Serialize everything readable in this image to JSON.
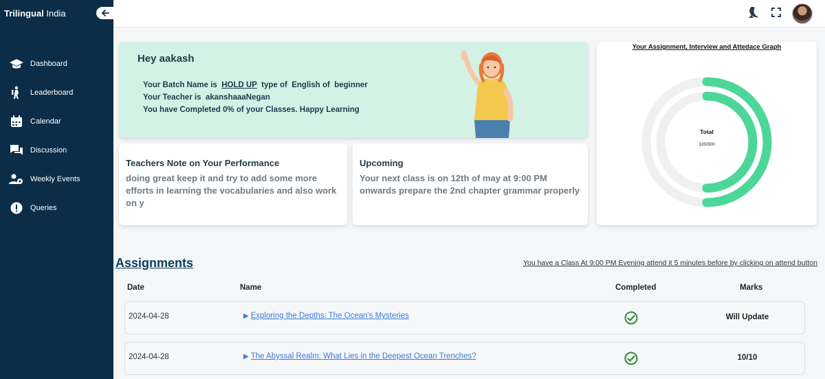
{
  "brand": {
    "bold": "Trilingual",
    "light": "India"
  },
  "sidebar": {
    "items": [
      {
        "label": "Dashboard",
        "icon": "graduation-cap-icon"
      },
      {
        "label": "Leaderboard",
        "icon": "hiking-person-icon"
      },
      {
        "label": "Calendar",
        "icon": "calendar-icon"
      },
      {
        "label": "Discussion",
        "icon": "chat-bubbles-icon"
      },
      {
        "label": "Weekly Events",
        "icon": "users-gear-icon"
      },
      {
        "label": "Queries",
        "icon": "exclamation-circle-icon"
      }
    ]
  },
  "topbar": {
    "icons": [
      "theme-toggle-icon",
      "fullscreen-icon",
      "avatar"
    ]
  },
  "welcome": {
    "greeting": "Hey aakash",
    "batch_prefix": "Your Batch Name is",
    "batch_name": "HOLD UP",
    "batch_mid": "type of",
    "batch_type": "English of",
    "batch_level": "beginner",
    "teacher_prefix": "Your Teacher is",
    "teacher_name": "akanshaaaNegan",
    "progress_text": "You have Completed 0% of your Classes. Happy Learning"
  },
  "note": {
    "title": "Teachers Note on Your Performance",
    "body": "doing great keep it and try to add some more efforts in learning the vocabularies and also work on y"
  },
  "upcoming": {
    "title": "Upcoming",
    "body": "Your next class is on 12th of may at 9:00 PM onwards prepare the 2nd chapter grammar properly"
  },
  "graph": {
    "title": "Your Assignment, Interview and Attedace Graph",
    "center_label": "Total",
    "center_value": "120/300",
    "colors": {
      "progress": "#4cd69a",
      "track": "#f0f0f0"
    }
  },
  "chart_data": {
    "type": "radial-bar",
    "title": "Your Assignment, Interview and Attedace Graph",
    "series": [
      {
        "fraction": 0.5
      },
      {
        "fraction": 0.5
      }
    ],
    "total_label": "Total",
    "total_value": "120/300"
  },
  "assignments": {
    "title": "Assignments",
    "class_notice": "You have a Class At 9:00 PM Evening attend it 5 minutes before by clicking on attend button",
    "headers": {
      "date": "Date",
      "name": "Name",
      "completed": "Completed",
      "marks": "Marks"
    },
    "rows": [
      {
        "date": "2024-04-28",
        "name": "Exploring the Depths: The Ocean's Mysteries",
        "completed": true,
        "marks": "Will Update"
      },
      {
        "date": "2024-04-28",
        "name": "The Abyssal Realm: What Lies in the Deepest Ocean Trenches?",
        "completed": true,
        "marks": "10/10"
      }
    ]
  }
}
